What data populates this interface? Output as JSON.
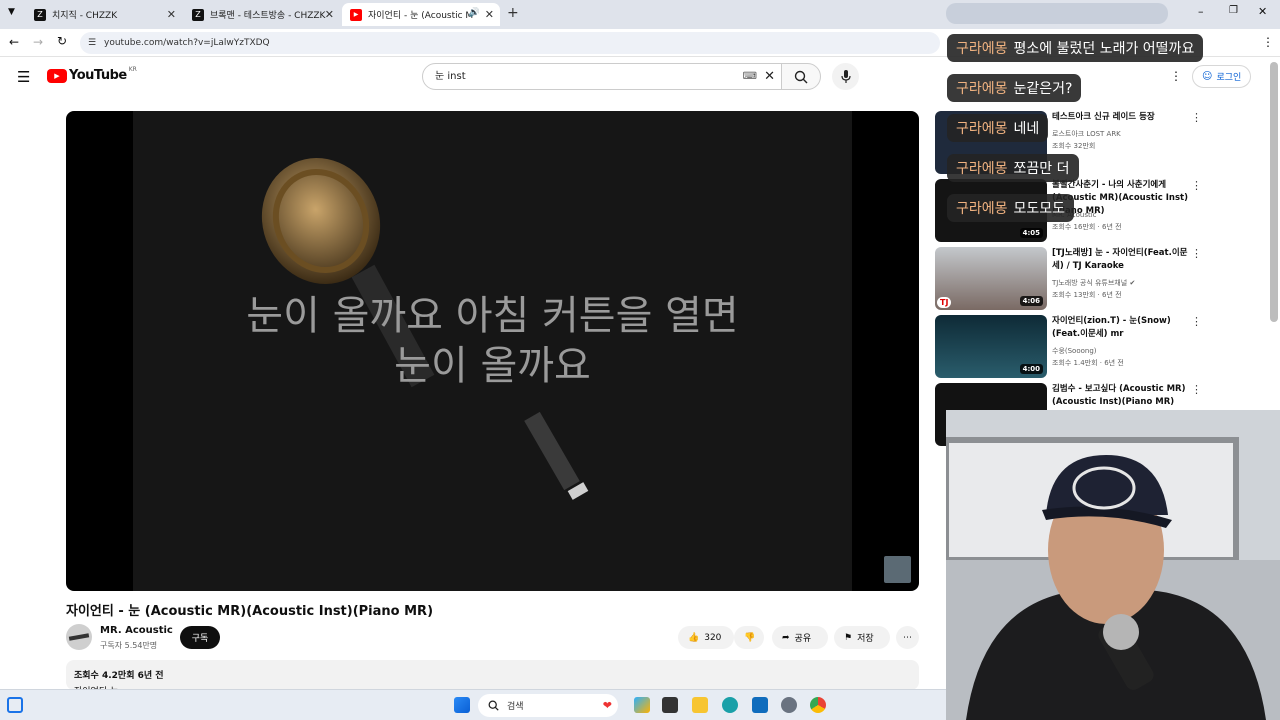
{
  "browser": {
    "tabs": [
      {
        "label": "치지직 - CHZZK"
      },
      {
        "label": "브록맨 - 테스트방송 - CHZZK"
      },
      {
        "label": "자이언티 - 눈 (Acoustic M"
      }
    ],
    "url": "youtube.com/watch?v=jLalwYzTXDQ"
  },
  "youtube": {
    "logo": "YouTube",
    "region": "KR",
    "search_value": "눈 inst",
    "login_label": "로그인"
  },
  "video": {
    "lyric_line1": "눈이 올까요 아침 커튼을 열면",
    "lyric_line2": "눈이 올까요",
    "title": "자이언티 - 눈 (Acoustic MR)(Acoustic Inst)(Piano MR)",
    "channel": "MR. Acoustic",
    "subscribers": "구독자 5.54만명",
    "subscribe_label": "구독",
    "likes": "320",
    "share_label": "공유",
    "save_label": "저장",
    "views_age": "조회수 4.2만회  6년 전",
    "desc_line": "자이언티-눈"
  },
  "recommendations": [
    {
      "title": "테스트아크 신규 레이드 등장",
      "channel": "로스트아크 LOST ARK",
      "meta": "조회수 32만회",
      "duration": ""
    },
    {
      "title": "볼빨간사춘기 - 나의 사춘기에게 (Acoustic MR)(Acoustic Inst)(Piano MR)",
      "channel": "MR. Acoustic",
      "meta": "조회수 16만회 · 6년 전",
      "duration": "4:05"
    },
    {
      "title": "[TJ노래방] 눈 - 자이언티(Feat.이문세) / TJ Karaoke",
      "channel": "TJ노래방 공식 유튜브채널",
      "meta": "조회수 13만회 · 6년 전",
      "duration": "4:06"
    },
    {
      "title": "자이언티(zion.T) - 눈(Snow) (Feat.이문세) mr",
      "channel": "수웅(Sooong)",
      "meta": "조회수 1.4만회 · 6년 전",
      "duration": "4:00"
    },
    {
      "title": "김범수 - 보고싶다 (Acoustic MR)(Acoustic Inst)(Piano MR)",
      "channel": "",
      "meta": "",
      "duration": ""
    }
  ],
  "chat": [
    {
      "nick": "구라에몽",
      "msg": "평소에 불렀던 노래가 어떨까요"
    },
    {
      "nick": "구라에몽",
      "msg": "눈같은거?"
    },
    {
      "nick": "구라에몽",
      "msg": "네네"
    },
    {
      "nick": "구라에몽",
      "msg": "쪼끔만 더"
    },
    {
      "nick": "구라에몽",
      "msg": "모도모도"
    }
  ],
  "taskbar": {
    "search_label": "검색"
  },
  "colors": {
    "yt_red": "#ff0000",
    "chat_nick": "#f0b280",
    "link_blue": "#065fd4"
  }
}
